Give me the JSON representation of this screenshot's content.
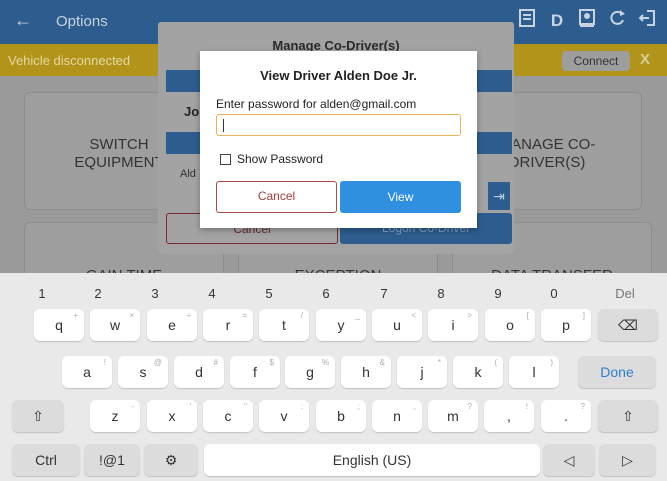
{
  "app": {
    "topbar": {
      "back_glyph": "←",
      "title": "Options",
      "icons": [
        "document-icon",
        "D",
        "driver-icon",
        "refresh-icon",
        "logout-icon"
      ],
      "d_label": "D"
    },
    "alert": {
      "message": "Vehicle disconnected",
      "connect_label": "Connect",
      "close_label": "X"
    },
    "tiles": [
      {
        "label": "SWITCH\nEQUIPMENT"
      },
      {
        "label": "MANAGE CO-\nDRIVER(S)"
      },
      {
        "label": "GAIN TIME"
      },
      {
        "label": "EXCEPTION"
      },
      {
        "label": "DATA TRANSFER"
      }
    ],
    "back_dialog": {
      "title": "Manage Co-Driver(s)",
      "join_text": "Jo",
      "alden_text": "Ald",
      "cancel_label": "Cancel",
      "logon_label": "Logon Co-Driver"
    }
  },
  "dialog": {
    "title": "View Driver Alden Doe Jr.",
    "prompt": "Enter password for alden@gmail.com",
    "password_value": "",
    "show_password_label": "Show Password",
    "cancel_label": "Cancel",
    "view_label": "View",
    "accent_color": "#2f8fe0",
    "cancel_color": "#b04848"
  },
  "keyboard": {
    "numbers": [
      "1",
      "2",
      "3",
      "4",
      "5",
      "6",
      "7",
      "8",
      "9",
      "0",
      "Del"
    ],
    "row1": [
      [
        "q",
        "+"
      ],
      [
        "w",
        "×"
      ],
      [
        "e",
        "÷"
      ],
      [
        "r",
        "="
      ],
      [
        "t",
        "/"
      ],
      [
        "y",
        "_"
      ],
      [
        "u",
        "<"
      ],
      [
        "i",
        ">"
      ],
      [
        "o",
        "["
      ],
      [
        "p",
        "]"
      ]
    ],
    "row2": [
      [
        "a",
        "!"
      ],
      [
        "s",
        "@"
      ],
      [
        "d",
        "#"
      ],
      [
        "f",
        "$"
      ],
      [
        "g",
        "%"
      ],
      [
        "h",
        "&"
      ],
      [
        "j",
        "*"
      ],
      [
        "k",
        "("
      ],
      [
        "l",
        ")"
      ]
    ],
    "row3": [
      [
        "z",
        "-"
      ],
      [
        "x",
        "'"
      ],
      [
        "c",
        "\""
      ],
      [
        "v",
        ":"
      ],
      [
        "b",
        ";"
      ],
      [
        "n",
        ","
      ],
      [
        "m",
        "?"
      ]
    ],
    "backspace_glyph": "⌫",
    "done_label": "Done",
    "shift_glyph": "⇧",
    "comma": ",",
    "comma_sub": "!",
    "period": ".",
    "period_sub": "?",
    "ctrl_label": "Ctrl",
    "symbols_label": "!@1",
    "settings_glyph": "⚙",
    "space_label": "English (US)",
    "left_glyph": "◁",
    "right_glyph": "▷"
  }
}
